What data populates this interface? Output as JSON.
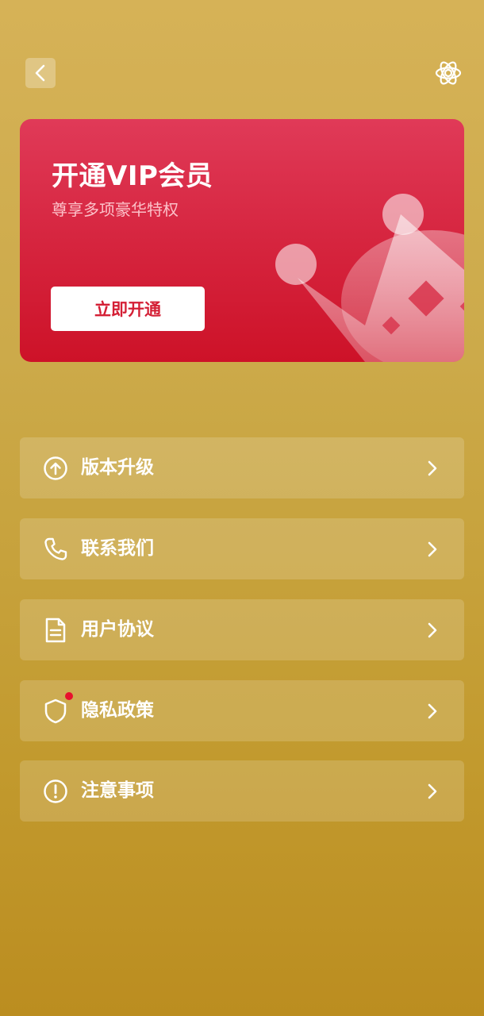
{
  "header": {
    "back_icon": "chevron-left-icon",
    "settings_icon": "atom-settings-icon"
  },
  "vip_card": {
    "title": "开通VIP会员",
    "subtitle": "尊享多项豪华特权",
    "button_label": "立即开通",
    "decoration_icon": "crown-icon",
    "colors": {
      "card_top": "#e03a58",
      "card_bottom": "#cd1228",
      "button_text": "#d41f35"
    }
  },
  "menu": {
    "items": [
      {
        "label": "版本升级",
        "icon": "upgrade-arrow-icon"
      },
      {
        "label": "联系我们",
        "icon": "phone-icon"
      },
      {
        "label": "用户协议",
        "icon": "document-icon"
      },
      {
        "label": "隐私政策",
        "icon": "shield-icon",
        "badge": "red-dot"
      },
      {
        "label": "注意事项",
        "icon": "alert-circle-icon"
      }
    ],
    "chevron_icon": "chevron-right-icon"
  },
  "theme": {
    "background_top": "#d6b257",
    "background_bottom": "#bb8d20",
    "text": "#ffffff",
    "badge": "#e8112d"
  }
}
